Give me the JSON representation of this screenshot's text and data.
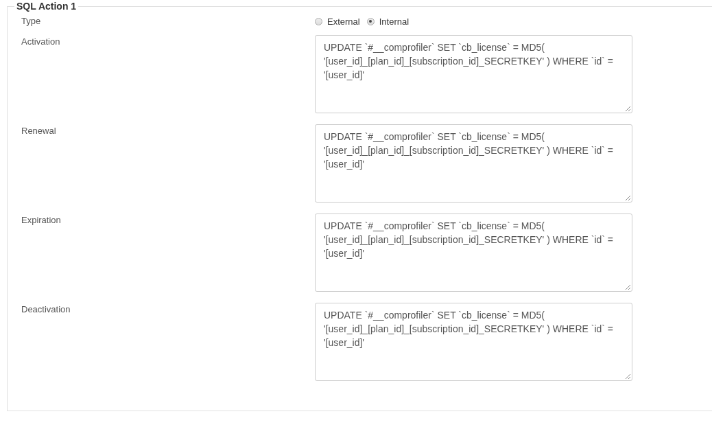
{
  "section": {
    "title": "SQL Action 1"
  },
  "type_field": {
    "label": "Type",
    "options": [
      {
        "label": "External",
        "selected": false
      },
      {
        "label": "Internal",
        "selected": true
      }
    ]
  },
  "fields": [
    {
      "label": "Activation",
      "value": "UPDATE `#__comprofiler` SET `cb_license` = MD5( '[user_id]_[plan_id]_[subscription_id]_SECRETKEY' ) WHERE `id` = '[user_id]'"
    },
    {
      "label": "Renewal",
      "value": "UPDATE `#__comprofiler` SET `cb_license` = MD5( '[user_id]_[plan_id]_[subscription_id]_SECRETKEY' ) WHERE `id` = '[user_id]'"
    },
    {
      "label": "Expiration",
      "value": "UPDATE `#__comprofiler` SET `cb_license` = MD5( '[user_id]_[plan_id]_[subscription_id]_SECRETKEY' ) WHERE `id` = '[user_id]'"
    },
    {
      "label": "Deactivation",
      "value": "UPDATE `#__comprofiler` SET `cb_license` = MD5( '[user_id]_[plan_id]_[subscription_id]_SECRETKEY' ) WHERE `id` = '[user_id]'"
    }
  ]
}
